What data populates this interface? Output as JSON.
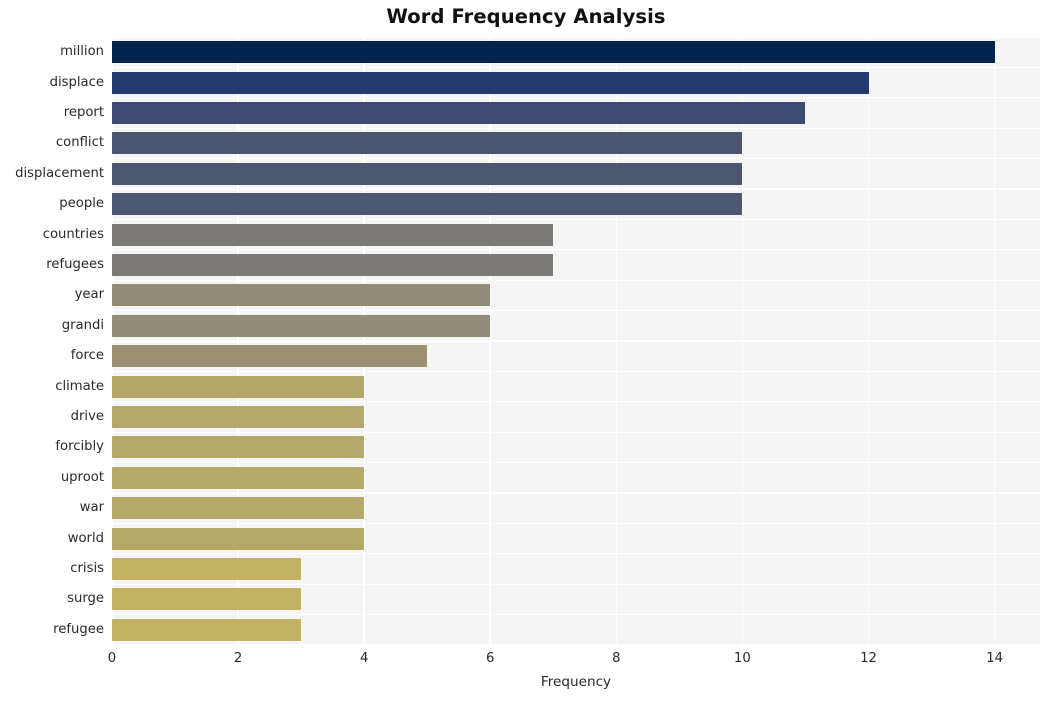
{
  "chart_data": {
    "type": "bar",
    "orientation": "horizontal",
    "title": "Word Frequency Analysis",
    "xlabel": "Frequency",
    "ylabel": "",
    "categories": [
      "million",
      "displace",
      "report",
      "conflict",
      "displacement",
      "people",
      "countries",
      "refugees",
      "year",
      "grandi",
      "force",
      "climate",
      "drive",
      "forcibly",
      "uproot",
      "war",
      "world",
      "crisis",
      "surge",
      "refugee"
    ],
    "values": [
      14,
      12,
      11,
      10,
      10,
      10,
      7,
      7,
      6,
      6,
      5,
      4,
      4,
      4,
      4,
      4,
      4,
      3,
      3,
      3
    ],
    "bar_colors": [
      "#04244c",
      "#233a6c",
      "#3e4a72",
      "#4b5470",
      "#4d566f",
      "#4e5771",
      "#7c7a77",
      "#7d7b78",
      "#918c78",
      "#928d79",
      "#9a9172",
      "#b3a76a",
      "#b4a86a",
      "#b4a86a",
      "#b5a96a",
      "#b5a96a",
      "#b5a96a",
      "#c2b264",
      "#c2b264",
      "#c2b264"
    ],
    "xticks": [
      0,
      2,
      4,
      6,
      8,
      10,
      12,
      14
    ],
    "xlim": [
      0,
      14.72
    ],
    "grid": true,
    "legend": false,
    "plot_background": "#f5f5f5",
    "gridline_color": "#ffffff",
    "figure_background": "#ffffff"
  }
}
